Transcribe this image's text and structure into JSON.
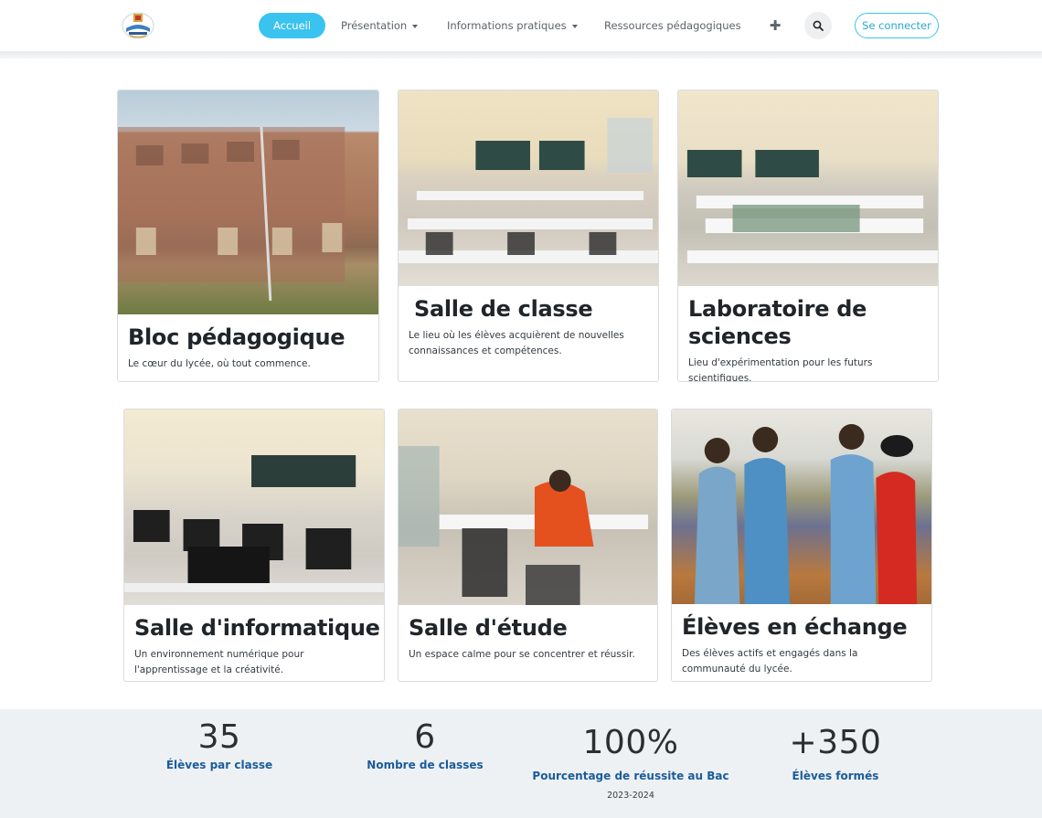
{
  "header": {
    "nav": {
      "home": "Accueil",
      "presentation": "Présentation",
      "practical_info": "Informations pratiques",
      "resources": "Ressources pédagogiques"
    },
    "login_label": "Se connecter"
  },
  "cards": [
    {
      "title": "Bloc pédagogique",
      "text": "Le cœur du lycée, où tout commence."
    },
    {
      "title": "Salle de classe",
      "text": "Le lieu où les élèves acquièrent de nouvelles connaissances et compétences."
    },
    {
      "title": "Laboratoire de sciences",
      "text": "Lieu d'expérimentation pour les futurs scientifiques."
    },
    {
      "title": "Salle d'informatique",
      "text": "Un environnement numérique pour l'apprentissage et la créativité."
    },
    {
      "title": "Salle d'étude",
      "text": "Un espace calme pour se concentrer et réussir."
    },
    {
      "title": "Élèves en échange",
      "text": "Des élèves actifs et engagés dans la communauté du lycée."
    }
  ],
  "stats": [
    {
      "value": "35",
      "label": "Élèves par classe"
    },
    {
      "value": "6",
      "label": "Nombre de classes"
    },
    {
      "value": "100%",
      "label": "Pourcentage de réussite au Bac",
      "sub": "2023-2024"
    },
    {
      "value": "+350",
      "label": "Élèves formés"
    }
  ],
  "colors": {
    "accent": "#3bc3f0",
    "stat_label": "#1a5c9a",
    "stats_bg": "#eef1f4"
  }
}
